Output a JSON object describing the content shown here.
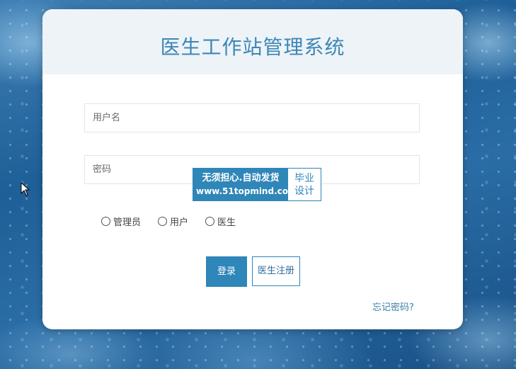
{
  "app": {
    "title": "医生工作站管理系统"
  },
  "form": {
    "username_placeholder": "用户名",
    "password_placeholder": "密码",
    "roles": [
      "管理员",
      "用户",
      "医生"
    ],
    "login_label": "登录",
    "register_label": "医生注册",
    "forgot_label": "忘记密码?"
  },
  "watermark": {
    "line1": "无须担心.自动发货",
    "line2": "www.51topmind.com",
    "badge_top": "毕业",
    "badge_bottom": "设计"
  },
  "colors": {
    "accent": "#2f86b8",
    "title": "#3c87b6",
    "header_bg": "#eef3f7"
  },
  "icons": [
    "mouse-pointer-icon",
    "radio-icon"
  ]
}
